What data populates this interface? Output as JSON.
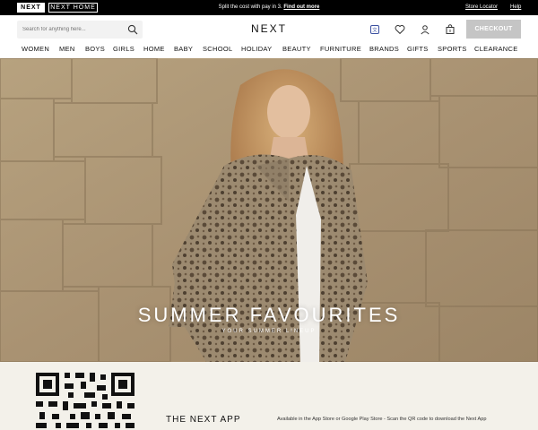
{
  "topbar": {
    "brand_active": "NEXT",
    "brand_home": "NEXT HOME",
    "promo_text": "Split the cost with pay in 3.",
    "promo_link": "Find out more",
    "store_locator": "Store Locator",
    "help": "Help"
  },
  "header": {
    "search_placeholder": "Search for anything here...",
    "logo": "NEXT",
    "checkout_label": "CHECKOUT",
    "icons": [
      "language-icon",
      "heart-icon",
      "account-icon",
      "bag-icon"
    ]
  },
  "nav": {
    "items": [
      "WOMEN",
      "MEN",
      "BOYS",
      "GIRLS",
      "HOME",
      "BABY",
      "SCHOOL",
      "HOLIDAY",
      "BEAUTY",
      "FURNITURE",
      "BRANDS",
      "GIFTS",
      "SPORTS",
      "CLEARANCE"
    ]
  },
  "hero": {
    "title": "SUMMER FAVOURITES",
    "subtitle": "YOUR SUMMER LINEUP"
  },
  "app_promo": {
    "title": "THE NEXT APP",
    "text": "Available in the App Store or Google Play Store - Scan the QR code to download the Next App"
  },
  "colors": {
    "topbar": "#000000",
    "checkout": "#c5c5c5",
    "language_icon": "#3a4fa0",
    "app_bg": "#f3f1ea"
  }
}
